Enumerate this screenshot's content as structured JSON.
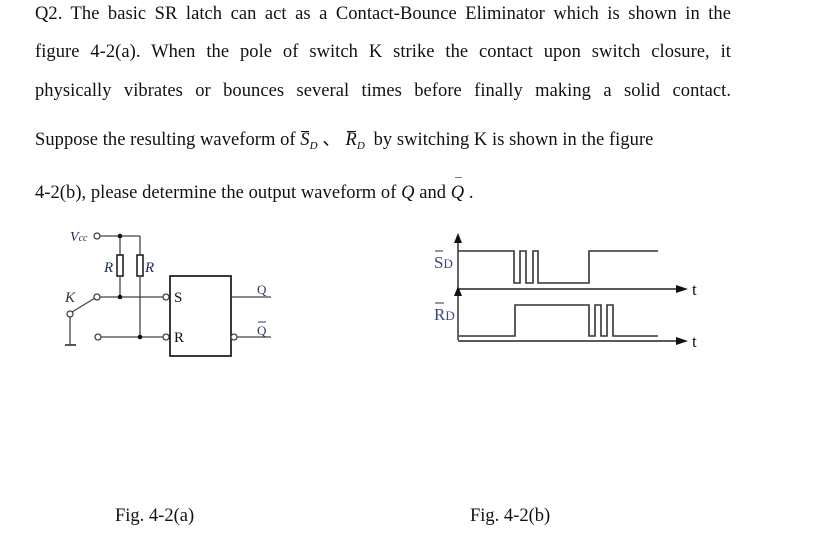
{
  "question": {
    "line1": "Q2. The basic SR latch can act as a Contact-Bounce Eliminator which is shown in the",
    "line2": "figure 4-2(a). When the pole of switch K strike the contact upon switch closure, it",
    "line3": "physically vibrates or bounces several times before finally making a solid contact.",
    "line4_pre": "Suppose the resulting waveform of ",
    "sd_symbol": "S",
    "sd_sub": "D",
    "separator": "、",
    "rd_symbol": "R",
    "rd_sub": "D",
    "line4_post": " by switching K is shown in the figure",
    "line5_pre": "4-2(b), please determine the output waveform of ",
    "q_symbol": "Q",
    "and_word": " and ",
    "qbar_symbol": "Q",
    "line5_post": " ."
  },
  "figure_a": {
    "caption": "Fig. 4-2(a)",
    "vcc_label": "V",
    "vcc_sub": "cc",
    "resistor_left_label": "R",
    "resistor_right_label": "R",
    "switch_label": "K",
    "latch_input_s": "S",
    "latch_input_r": "R",
    "output_q": "Q",
    "output_qbar": "Q"
  },
  "figure_b": {
    "caption": "Fig. 4-2(b)",
    "signal_top_label": "S",
    "signal_top_sub": "D",
    "signal_bottom_label": "R",
    "signal_bottom_sub": "D",
    "time_axis_label": "t",
    "signal_top_sequence": [
      "high",
      "bounce",
      "bounce",
      "low",
      "high"
    ],
    "signal_bottom_sequence": [
      "low",
      "high",
      "bounce",
      "bounce",
      "low"
    ]
  }
}
